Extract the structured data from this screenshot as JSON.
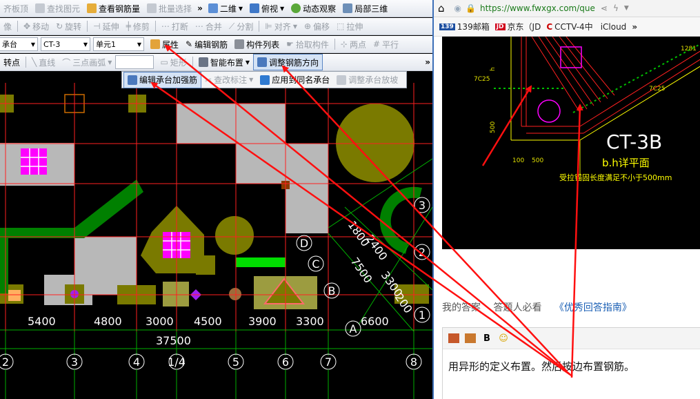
{
  "toolbar1": {
    "items": [
      "齐板顶",
      "查找图元",
      "查看钢筋量",
      "批量选择"
    ],
    "view_2d": "二维",
    "view_top": "俯视",
    "dynamic": "动态观察",
    "local3d": "局部三维"
  },
  "toolbar2": {
    "items": [
      "像",
      "移动",
      "旋转",
      "延伸",
      "修剪",
      "打断",
      "合并",
      "分割",
      "对齐",
      "偏移",
      "拉伸"
    ]
  },
  "toolbar3": {
    "combo1": "承台",
    "combo2": "CT-3",
    "combo3": "单元1",
    "items": [
      "属性",
      "编辑钢筋",
      "构件列表",
      "拾取构件",
      "两点",
      "平行"
    ]
  },
  "toolbar4": {
    "items": [
      "转点",
      "直线",
      "三点画弧",
      "矩形",
      "智能布置",
      "调整钢筋方向"
    ]
  },
  "popup": {
    "items": [
      "编辑承台加强筋",
      "查改标注",
      "应用到同名承台",
      "调整承台放坡"
    ]
  },
  "drawing": {
    "dims": [
      "5400",
      "4800",
      "3000",
      "4500",
      "3900",
      "3300",
      "6600"
    ],
    "total": "37500",
    "axes_x": [
      "2",
      "3",
      "4",
      "1/4",
      "5",
      "6",
      "7",
      "8"
    ],
    "axes_y": [
      "D",
      "C",
      "B",
      "A"
    ],
    "axes_right": [
      "3",
      "2",
      "1"
    ],
    "diag_dims": [
      "1800",
      "2400",
      "7500",
      "3300",
      "200"
    ]
  },
  "browser": {
    "url": "https://www.fwxgx.com/que",
    "bookmarks": [
      "139邮箱",
      "京东（JD",
      "CCTV-4中",
      "iCloud"
    ],
    "cad_label": "CT-3B",
    "cad_sub": "b.h详平面",
    "cad_note": "受拉锚固长度满足不小于500mm",
    "cad_dims": [
      "7C25",
      "7C25",
      "100",
      "500",
      "500",
      "h",
      "1281"
    ],
    "tabs": [
      "我的答案",
      "答题人必看",
      "《优秀回答指南》"
    ],
    "answer": "用异形的定义布置。然后按边布置钢筋。"
  },
  "colors": {
    "accent": "#1a5fb4",
    "grid_red": "#ff2020",
    "green": "#008000",
    "olive": "#7a7a00",
    "magenta": "#ff00ff",
    "gray": "#b8b8b8"
  }
}
